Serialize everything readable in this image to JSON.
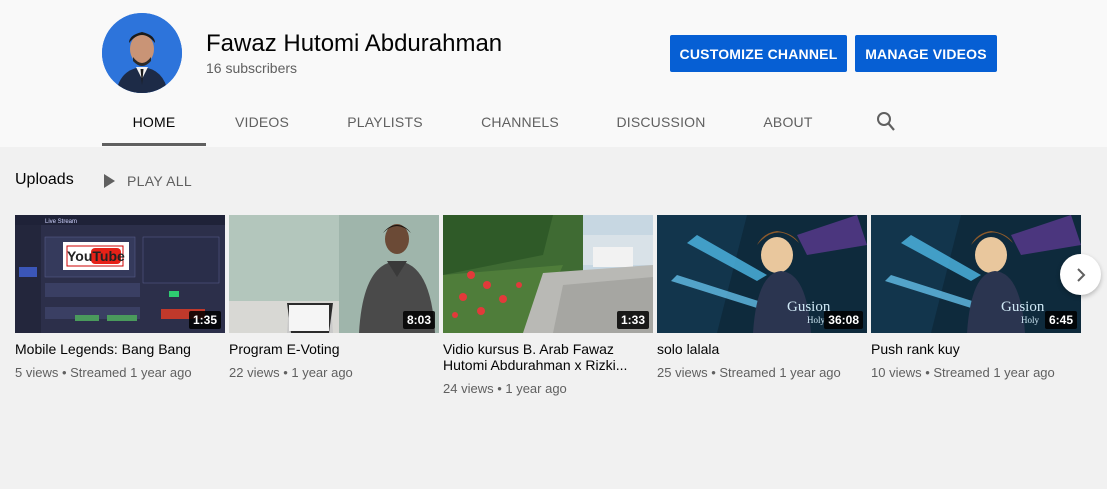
{
  "channel": {
    "name": "Fawaz Hutomi Abdurahman",
    "subscribers": "16 subscribers"
  },
  "actions": {
    "customize_label": "CUSTOMIZE CHANNEL",
    "manage_label": "MANAGE VIDEOS"
  },
  "tabs": [
    {
      "label": "HOME",
      "active": true
    },
    {
      "label": "VIDEOS"
    },
    {
      "label": "PLAYLISTS"
    },
    {
      "label": "CHANNELS"
    },
    {
      "label": "DISCUSSION"
    },
    {
      "label": "ABOUT"
    }
  ],
  "uploads": {
    "title": "Uploads",
    "play_all_label": "PLAY ALL",
    "videos": [
      {
        "title": "Mobile Legends: Bang Bang",
        "duration": "1:35",
        "views": "5 views",
        "age": "Streamed 1 year ago"
      },
      {
        "title": "Program E-Voting",
        "duration": "8:03",
        "views": "22 views",
        "age": "1 year ago"
      },
      {
        "title": "Vidio kursus B. Arab Fawaz Hutomi Abdurahman x Rizki...",
        "duration": "1:33",
        "views": "24 views",
        "age": "1 year ago"
      },
      {
        "title": "solo lalala",
        "duration": "36:08",
        "views": "25 views",
        "age": "Streamed 1 year ago"
      },
      {
        "title": "Push rank kuy",
        "duration": "6:45",
        "views": "10 views",
        "age": "Streamed 1 year ago"
      }
    ]
  },
  "thumb_text": {
    "live_stream": "Live Stream",
    "youtube_logo": "YouTube",
    "gusion": "Gusion",
    "holy": "Holy"
  },
  "colors": {
    "accent_blue": "#065fd4",
    "header_bg": "#f9f9f9",
    "page_bg": "#f1f1f1",
    "secondary_text": "#606060"
  },
  "icons": {
    "search": "search-icon",
    "play": "play-icon",
    "next": "chevron-right-icon"
  }
}
